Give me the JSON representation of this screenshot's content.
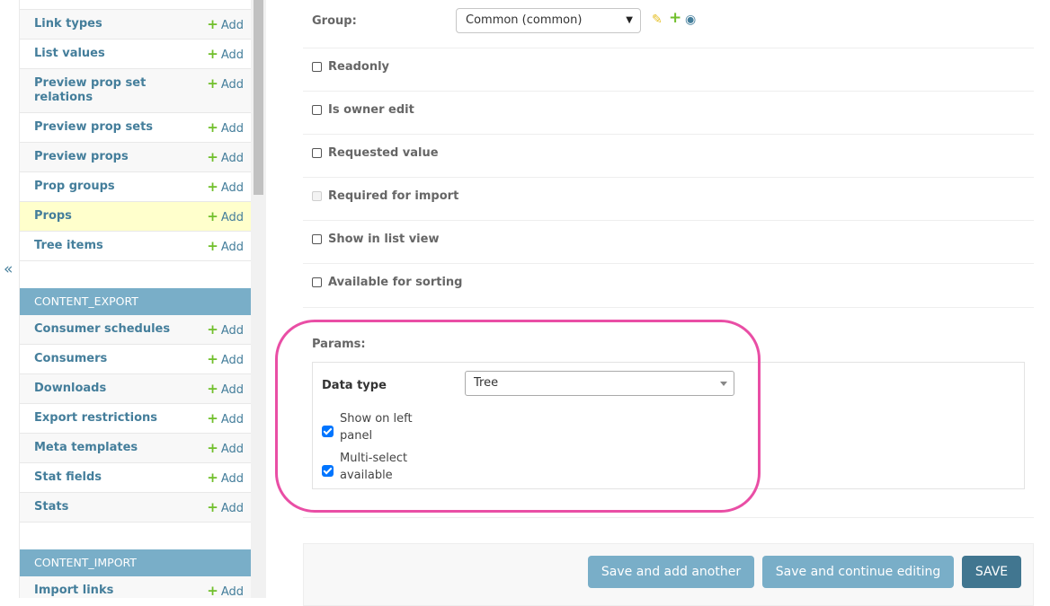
{
  "nav_toggle": {
    "glyph": "«"
  },
  "sidebar": {
    "add_label": "Add",
    "items_top": [
      {
        "label": "Link types"
      },
      {
        "label": "List values"
      },
      {
        "label": "Preview prop set relations"
      },
      {
        "label": "Preview prop sets"
      },
      {
        "label": "Preview props"
      },
      {
        "label": "Prop groups"
      },
      {
        "label": "Props",
        "active": true
      },
      {
        "label": "Tree items"
      }
    ],
    "section_export": {
      "caption": "CONTENT_EXPORT",
      "items": [
        {
          "label": "Consumer schedules"
        },
        {
          "label": "Consumers"
        },
        {
          "label": "Downloads"
        },
        {
          "label": "Export restrictions"
        },
        {
          "label": "Meta templates"
        },
        {
          "label": "Stat fields"
        },
        {
          "label": "Stats"
        }
      ]
    },
    "section_import": {
      "caption": "CONTENT_IMPORT",
      "items": [
        {
          "label": "Import links"
        }
      ]
    }
  },
  "form": {
    "group": {
      "label": "Group:",
      "value": "Common (common)"
    },
    "checkboxes": [
      {
        "label": "Readonly",
        "checked": false,
        "disabled": false
      },
      {
        "label": "Is owner edit",
        "checked": false,
        "disabled": false
      },
      {
        "label": "Requested value",
        "checked": false,
        "disabled": false
      },
      {
        "label": "Required for import",
        "checked": false,
        "disabled": true
      },
      {
        "label": "Show in list view",
        "checked": false,
        "disabled": false
      },
      {
        "label": "Available for sorting",
        "checked": false,
        "disabled": false
      }
    ],
    "params": {
      "label": "Params:",
      "data_type_label": "Data type",
      "data_type_value": "Tree",
      "show_on_left_panel": "Show on left panel",
      "multi_select_available": "Multi-select available"
    }
  },
  "buttons": {
    "save_add_another": "Save and add another",
    "save_continue": "Save and continue editing",
    "save": "SAVE"
  },
  "colors": {
    "link": "#447e9b",
    "add_plus": "#70bf2b",
    "section_caption_bg": "#79aec8",
    "active_row_bg": "#ffffcc",
    "highlight": "#e94ea5",
    "primary_button": "#417690",
    "secondary_button": "#79aec8"
  }
}
